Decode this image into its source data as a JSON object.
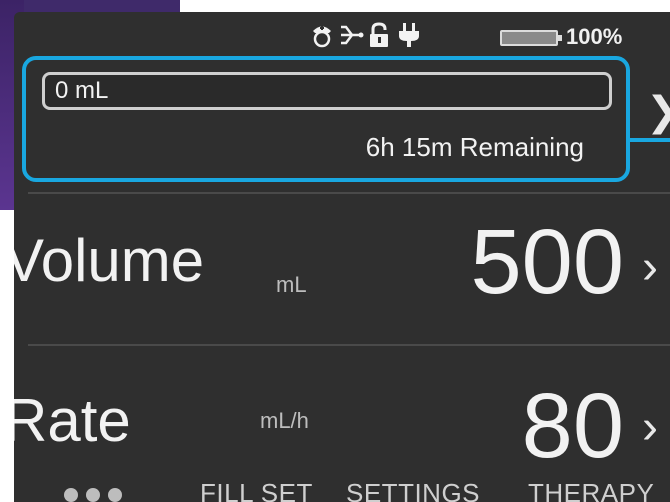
{
  "status_bar": {
    "icons": [
      "nurse-call-icon",
      "usb-connection-icon",
      "unlocked-icon",
      "ac-plug-icon",
      "battery-icon"
    ],
    "battery_level": 100,
    "battery_text": "100%"
  },
  "progress": {
    "volume_infused": "0 mL",
    "remaining": "6h 15m  Remaining"
  },
  "volume": {
    "label": "Volume",
    "unit": "mL",
    "value": "500"
  },
  "rate": {
    "label": "Rate",
    "unit": "mL/h",
    "value": "80"
  },
  "nav": {
    "more_dots": 3,
    "items": [
      "FILL SET",
      "SETTINGS",
      "THERAPY"
    ]
  },
  "colors": {
    "highlight": "#19a7e0",
    "screen_bg": "#2f2f2f",
    "text": "#f2f2f2"
  }
}
